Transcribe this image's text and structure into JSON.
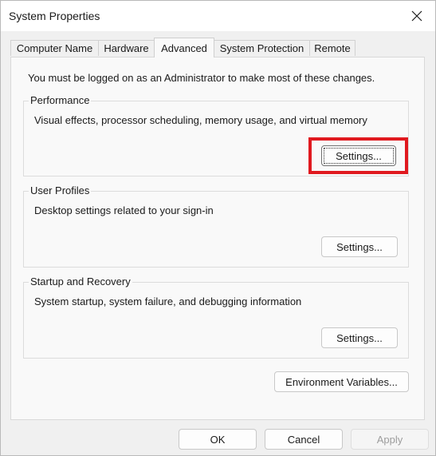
{
  "window": {
    "title": "System Properties"
  },
  "tabs": [
    {
      "label": "Computer Name"
    },
    {
      "label": "Hardware"
    },
    {
      "label": "Advanced"
    },
    {
      "label": "System Protection"
    },
    {
      "label": "Remote"
    }
  ],
  "active_tab": "Advanced",
  "admin_note": "You must be logged on as an Administrator to make most of these changes.",
  "groups": {
    "performance": {
      "title": "Performance",
      "description": "Visual effects, processor scheduling, memory usage, and virtual memory",
      "button": "Settings..."
    },
    "user_profiles": {
      "title": "User Profiles",
      "description": "Desktop settings related to your sign-in",
      "button": "Settings..."
    },
    "startup_recovery": {
      "title": "Startup and Recovery",
      "description": "System startup, system failure, and debugging information",
      "button": "Settings..."
    }
  },
  "env_button": "Environment Variables...",
  "footer": {
    "ok": "OK",
    "cancel": "Cancel",
    "apply": "Apply"
  },
  "colors": {
    "highlight": "#e0191f"
  },
  "icons": {
    "close": "close-icon"
  }
}
